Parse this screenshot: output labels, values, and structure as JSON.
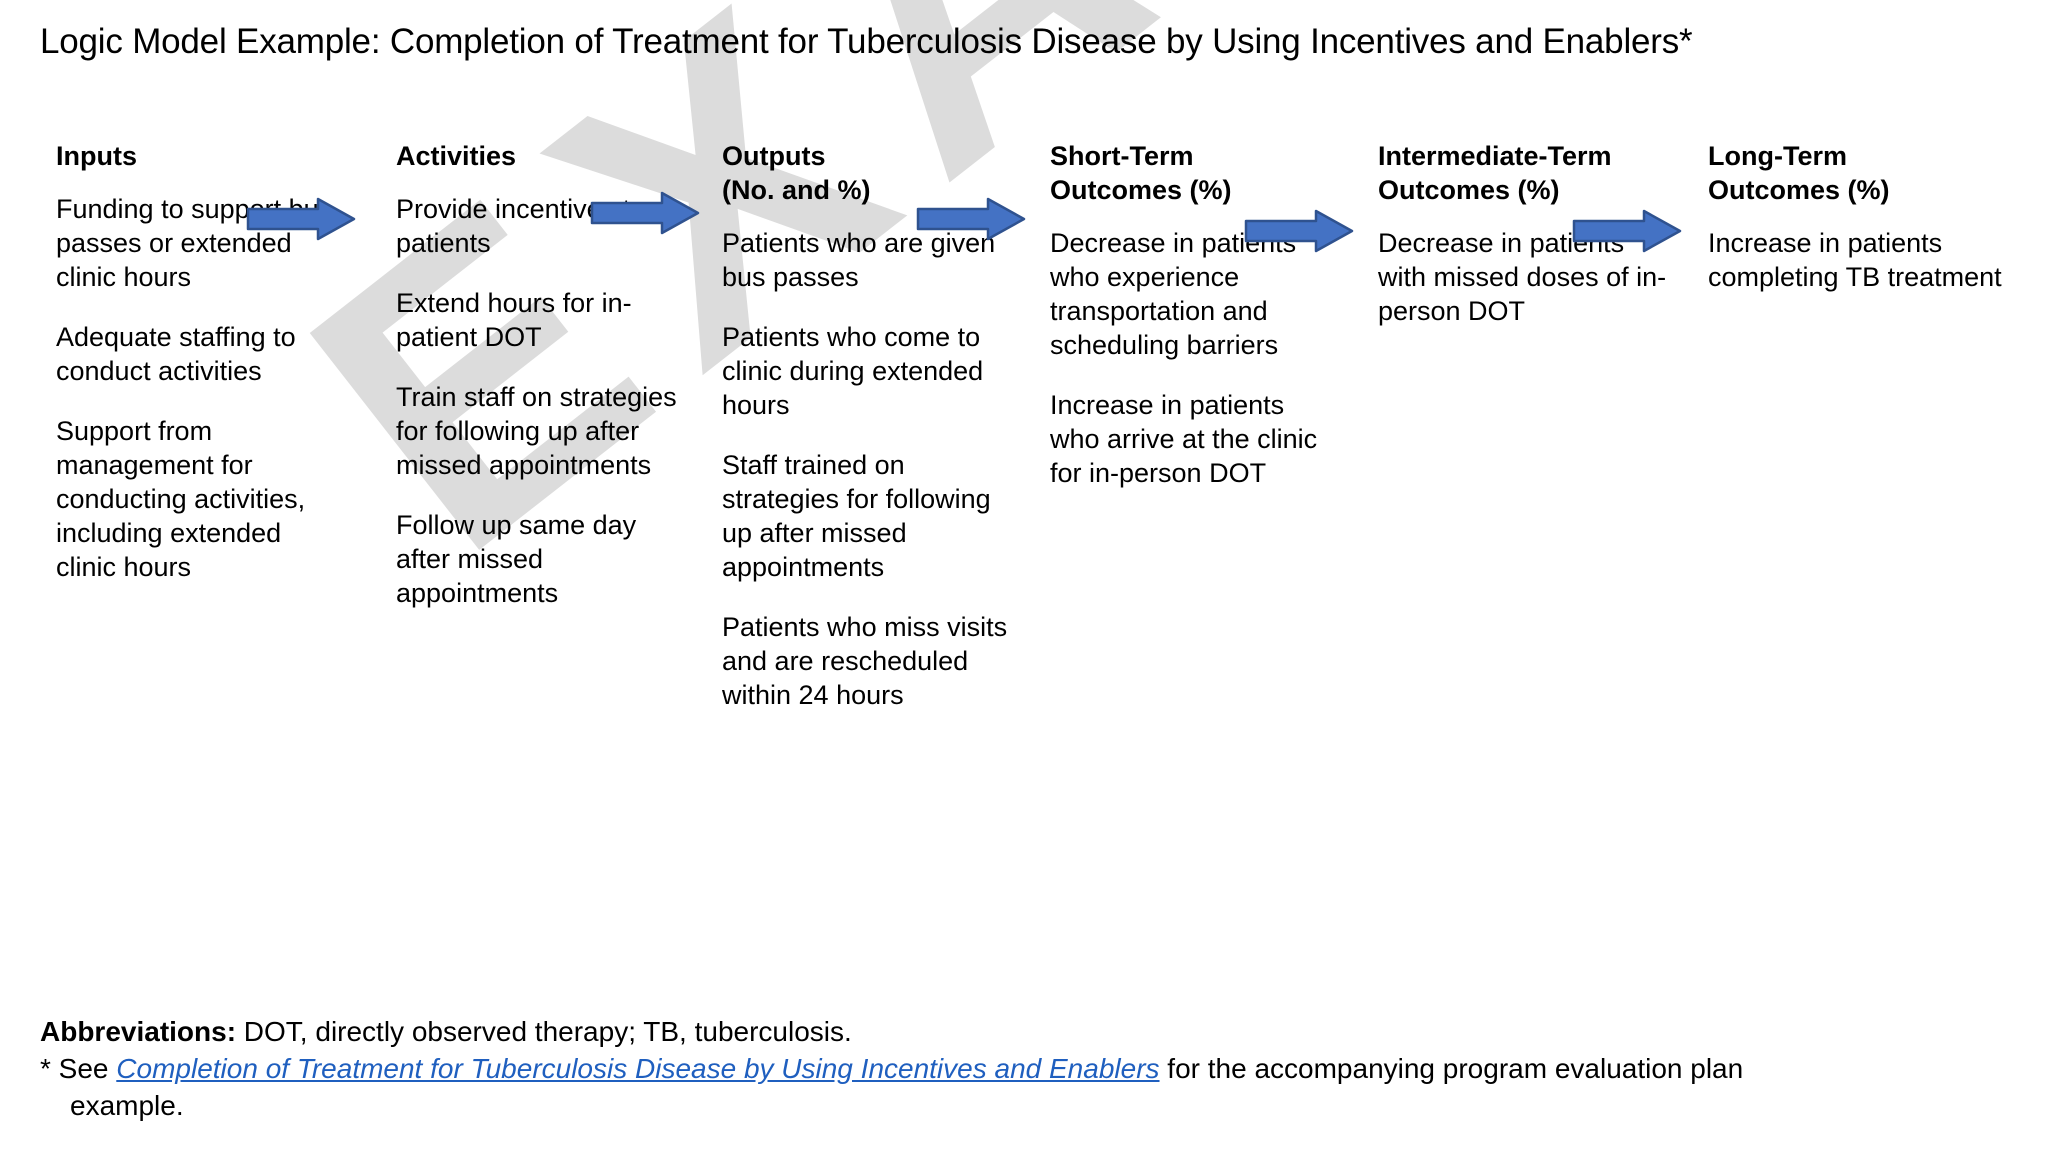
{
  "title": "Logic Model Example: Completion of Treatment for Tuberculosis Disease by Using Incentives and Enablers*",
  "colors": {
    "arrow_fill": "#4472C4",
    "arrow_stroke": "#2F528F",
    "link": "#1F5FBF",
    "watermark": "#DCDCDC",
    "text": "#000000"
  },
  "watermark": {
    "text": "EXAMPLE"
  },
  "columns": [
    {
      "id": "inputs",
      "header_line1": "Inputs",
      "header_line2": "",
      "items": [
        "Funding to support bus passes or extended clinic hours",
        "Adequate staffing to conduct activities",
        "Support from management for conducting activities, including extended clinic hours"
      ]
    },
    {
      "id": "activities",
      "header_line1": "Activities",
      "header_line2": "",
      "items": [
        "Provide incentives to patients",
        "Extend hours for in-patient DOT",
        "Train staff on strategies for following up after missed appointments",
        "Follow up same day after missed appointments"
      ]
    },
    {
      "id": "outputs",
      "header_line1": "Outputs",
      "header_line2": "(No. and %)",
      "items": [
        "Patients who are given bus passes",
        "Patients who come to clinic during extended hours",
        "Staff trained on strategies for following up after missed appointments",
        "Patients who miss visits and are rescheduled within 24 hours"
      ]
    },
    {
      "id": "short-term-outcomes",
      "header_line1": "Short-Term",
      "header_line2": "Outcomes (%)",
      "items": [
        "Decrease in patients who experience transportation and scheduling barriers",
        "Increase in patients who arrive at the clinic for in-person DOT"
      ]
    },
    {
      "id": "intermediate-term-outcomes",
      "header_line1": "Intermediate-Term",
      "header_line2": "Outcomes (%)",
      "items": [
        "Decrease in patients with missed doses of in-person DOT"
      ]
    },
    {
      "id": "long-term-outcomes",
      "header_line1": "Long-Term",
      "header_line2": "Outcomes (%)",
      "items": [
        "Increase in patients completing TB treatment"
      ]
    }
  ],
  "arrows": [
    {
      "name": "arrow-inputs-to-activities"
    },
    {
      "name": "arrow-activities-to-outputs"
    },
    {
      "name": "arrow-outputs-to-short-term"
    },
    {
      "name": "arrow-short-term-to-intermediate-term"
    },
    {
      "name": "arrow-intermediate-term-to-long-term"
    }
  ],
  "footnotes": {
    "abbrev_label": "Abbreviations:",
    "abbrev_text": " DOT, directly observed therapy; TB, tuberculosis.",
    "star_prefix": "* See ",
    "link_text": "Completion of Treatment for Tuberculosis Disease by Using Incentives and Enablers",
    "star_suffix": " for the accompanying program evaluation plan",
    "star_line2": "example."
  }
}
